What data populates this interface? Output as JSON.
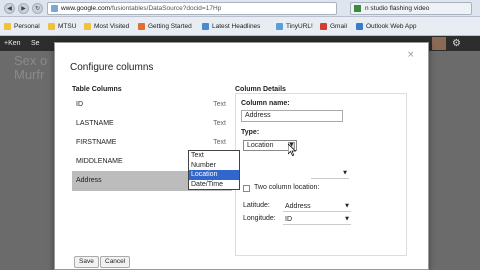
{
  "browser": {
    "url_domain": "www.google.com",
    "url_path": "/fusiontables/DataSource?docid=17Hp",
    "tab_title": "n studio flashing video",
    "bookmarks": [
      {
        "label": "Personal",
        "color": "#f0c040"
      },
      {
        "label": "MTSU",
        "color": "#f0c040"
      },
      {
        "label": "Most Visited",
        "color": "#f0c040"
      },
      {
        "label": "Getting Started",
        "color": "#e07030"
      },
      {
        "label": "Latest Headlines",
        "color": "#4a8ad0"
      },
      {
        "label": "TinyURL!",
        "color": "#5aa0d8"
      },
      {
        "label": "Gmail",
        "color": "#d04030"
      },
      {
        "label": "Outlook Web App",
        "color": "#3a7ac8"
      }
    ]
  },
  "appbar": {
    "user_link": "+Ken",
    "next_link": "Se"
  },
  "background": {
    "heading_1": "Sex o",
    "heading_2": "Murfr"
  },
  "dialog": {
    "title": "Configure columns",
    "close_glyph": "×",
    "table_columns_header": "Table Columns",
    "columns": [
      {
        "name": "ID",
        "type": "Text"
      },
      {
        "name": "LASTNAME",
        "type": "Text"
      },
      {
        "name": "FIRSTNAME",
        "type": "Text"
      },
      {
        "name": "MIDDLENAME",
        "type": "Text"
      },
      {
        "name": "Address",
        "type": "",
        "selected": true
      }
    ],
    "details": {
      "header": "Column Details",
      "name_label": "Column name:",
      "name_value": "Address",
      "type_label": "Type:",
      "type_value": "Location",
      "type_options": [
        "Text",
        "Number",
        "Location",
        "Date/Time"
      ],
      "type_highlighted": "Location",
      "two_col_label": "Two column location:",
      "latitude_label": "Latitude:",
      "latitude_value": "Address",
      "longitude_label": "Longitude:",
      "longitude_value": "ID"
    },
    "save_label": "Save",
    "cancel_label": "Cancel"
  },
  "colors": {
    "highlight": "#3366cc",
    "selected_row": "#bcbcbc",
    "overlay": "#6b6b6b"
  }
}
